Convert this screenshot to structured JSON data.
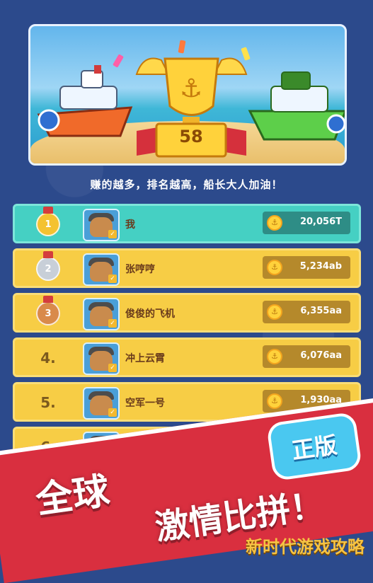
{
  "banner": {
    "trophy_number": "58"
  },
  "headline": "赚的越多，排名越高，船长大人加油！",
  "leaderboard": [
    {
      "rank": "1",
      "medal": "gold",
      "name": "我",
      "score": "20,056T",
      "highlight": true
    },
    {
      "rank": "2",
      "medal": "silver",
      "name": "张哼哼",
      "score": "5,234ab",
      "highlight": false
    },
    {
      "rank": "3",
      "medal": "bronze",
      "name": "俊俊的飞机",
      "score": "6,355aa",
      "highlight": false
    },
    {
      "rank": "4.",
      "medal": "none",
      "name": "冲上云霄",
      "score": "6,076aa",
      "highlight": false
    },
    {
      "rank": "5.",
      "medal": "none",
      "name": "空军一号",
      "score": "1,930aa",
      "highlight": false
    },
    {
      "rank": "6.",
      "medal": "none",
      "name": "",
      "score": "",
      "highlight": false
    }
  ],
  "promo": {
    "line1": "全球",
    "line2": "激情比拼！",
    "badge": "正版"
  },
  "watermark": "新时代游戏攻略",
  "colors": {
    "accent_teal": "#45d0c3",
    "row_yellow": "#f7cd45",
    "promo_red": "#d92f3f",
    "badge_blue": "#4ac8f0"
  }
}
